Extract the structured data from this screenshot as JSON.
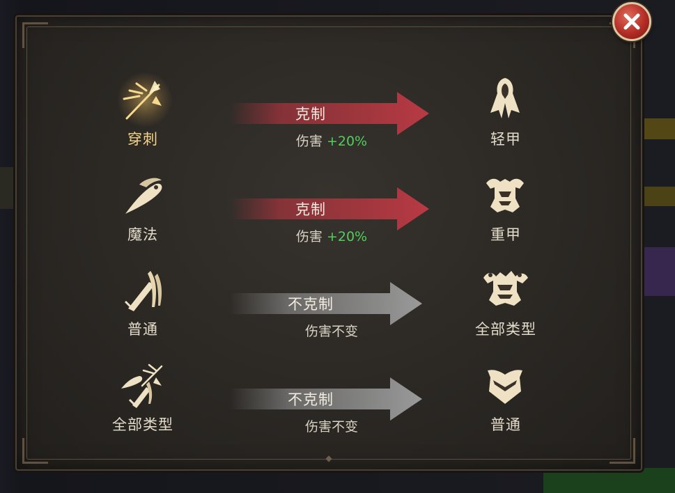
{
  "close_button": {
    "icon": "close-icon",
    "color": "#b22d25"
  },
  "rows": [
    {
      "attacker": {
        "icon": "spear-icon",
        "label": "穿刺",
        "highlighted": true
      },
      "relation": {
        "label": "克制",
        "damage_prefix": "伤害",
        "damage_value": "+20%",
        "arrow_color": "#a8343d"
      },
      "defender": {
        "icon": "light-armor-icon",
        "label": "轻甲"
      }
    },
    {
      "attacker": {
        "icon": "magic-icon",
        "label": "魔法",
        "highlighted": false
      },
      "relation": {
        "label": "克制",
        "damage_prefix": "伤害",
        "damage_value": "+20%",
        "arrow_color": "#a8343d"
      },
      "defender": {
        "icon": "heavy-armor-icon",
        "label": "重甲"
      }
    },
    {
      "attacker": {
        "icon": "sword-icon",
        "label": "普通",
        "highlighted": false
      },
      "relation": {
        "label": "不克制",
        "damage_prefix": "伤害不变",
        "damage_value": "",
        "arrow_color": "#8a8a8a"
      },
      "defender": {
        "icon": "all-armor-icon",
        "label": "全部类型"
      }
    },
    {
      "attacker": {
        "icon": "all-weapons-icon",
        "label": "全部类型",
        "highlighted": false
      },
      "relation": {
        "label": "不克制",
        "damage_prefix": "伤害不变",
        "damage_value": "",
        "arrow_color": "#8a8a8a"
      },
      "defender": {
        "icon": "normal-armor-icon",
        "label": "普通"
      }
    }
  ],
  "colors": {
    "positive": "#4fd05a",
    "highlight_label": "#f6d488",
    "icon": "#efe2c4"
  }
}
